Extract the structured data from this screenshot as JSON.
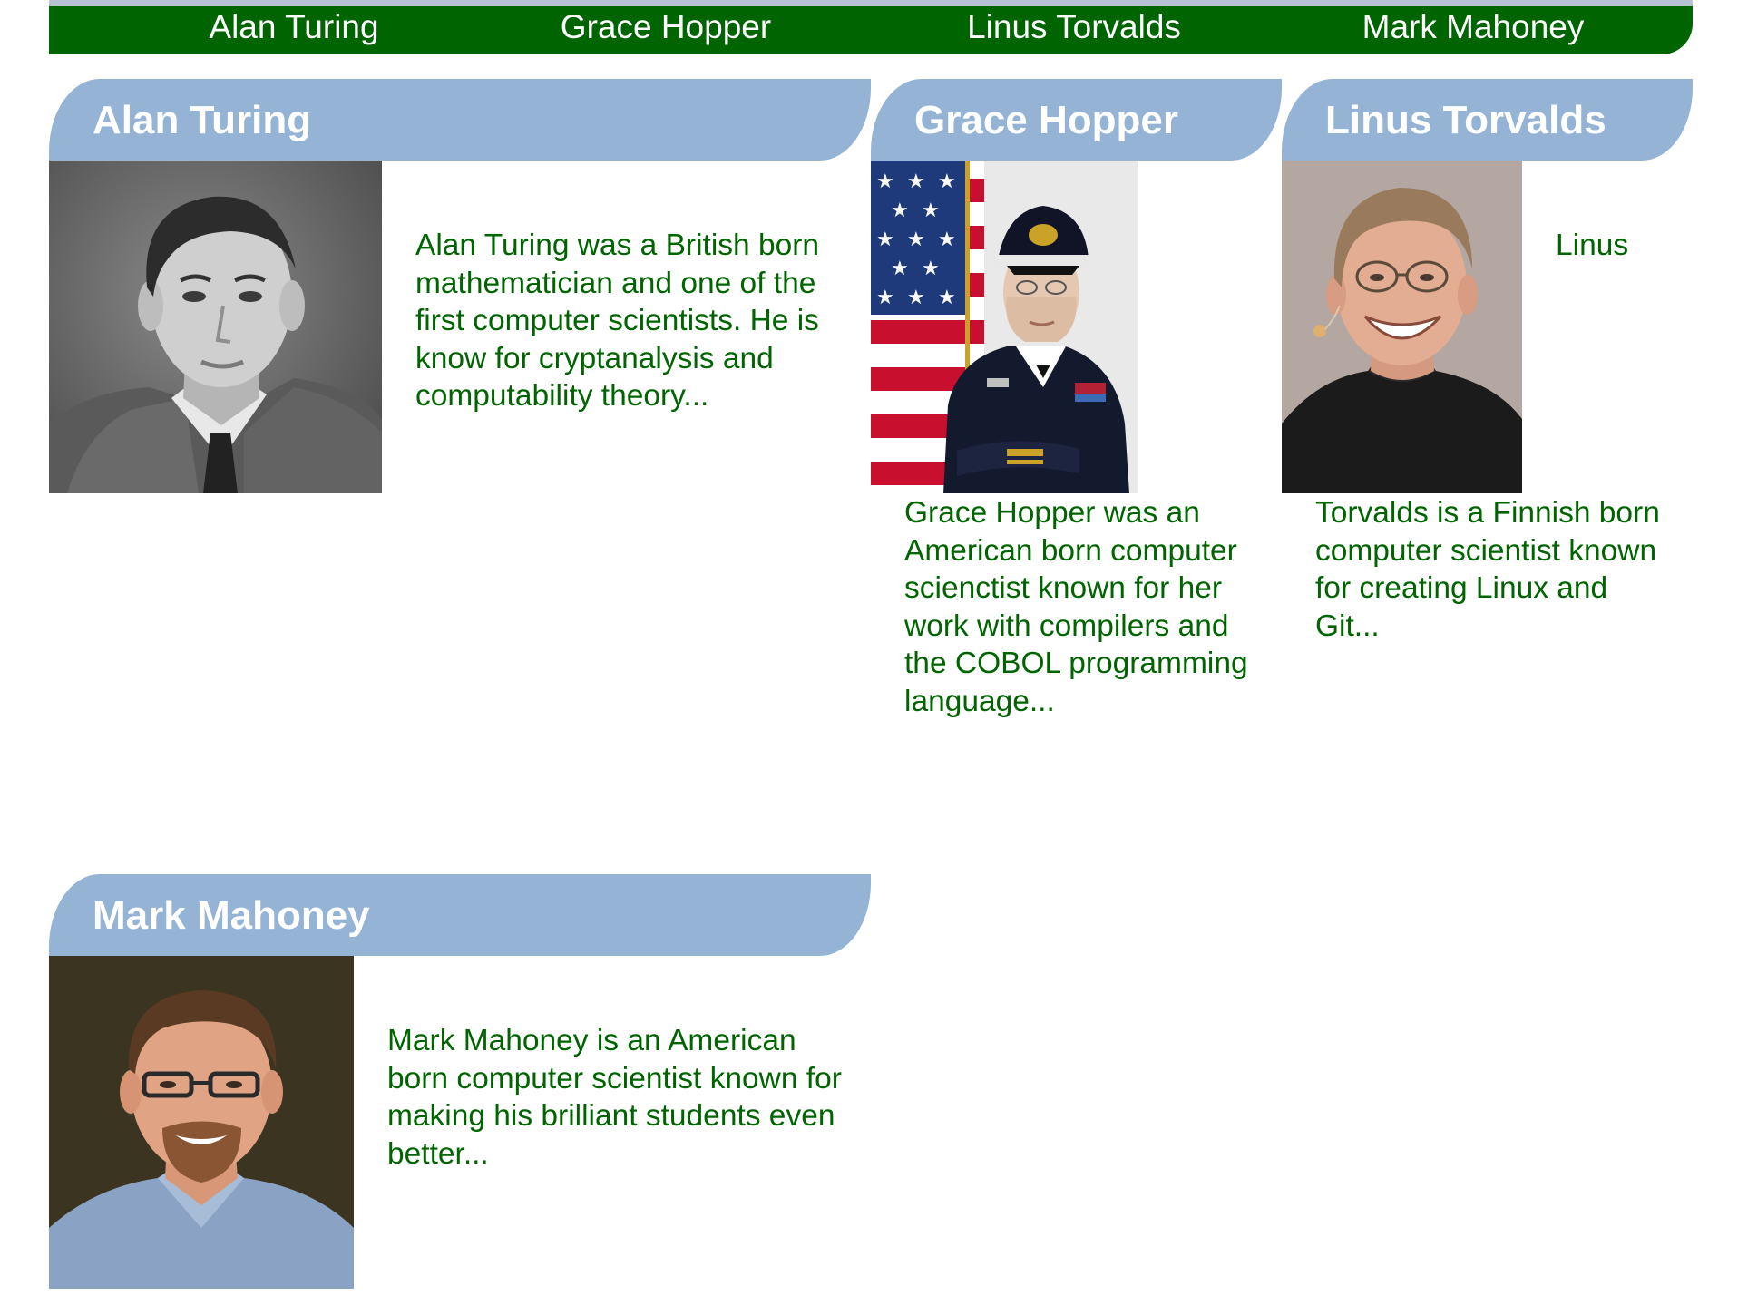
{
  "nav": {
    "items": [
      {
        "label": "Alan Turing"
      },
      {
        "label": "Grace Hopper"
      },
      {
        "label": "Linus Torvalds"
      },
      {
        "label": "Mark Mahoney"
      }
    ]
  },
  "colors": {
    "nav_background": "#006400",
    "nav_text": "#ffffff",
    "card_header_background": "#94b3d5",
    "card_header_text": "#ffffff",
    "bio_text": "#006400"
  },
  "profiles": [
    {
      "name": "Alan Turing",
      "bio": "Alan Turing was a British born mathematician and one of the first computer scientists. He is know for cryptanalysis and computability theory...",
      "photo": "black-and-white portrait photo of Alan Turing"
    },
    {
      "name": "Grace Hopper",
      "bio": "Grace Hopper was an American born computer scienctist known for her work with compilers and the COBOL programming language...",
      "photo": "portrait photo of Grace Hopper in navy uniform with American flag"
    },
    {
      "name": "Linus Torvalds",
      "bio_first_word": "Linus",
      "bio_rest": "Torvalds is a Finnish born computer scientist known for creating Linux and Git...",
      "photo": "portrait photo of Linus Torvalds smiling with glasses"
    },
    {
      "name": "Mark Mahoney",
      "bio": "Mark Mahoney is an American born computer scientist known for making his brilliant students even better...",
      "photo": "portrait photo of Mark Mahoney with glasses and goatee"
    }
  ]
}
